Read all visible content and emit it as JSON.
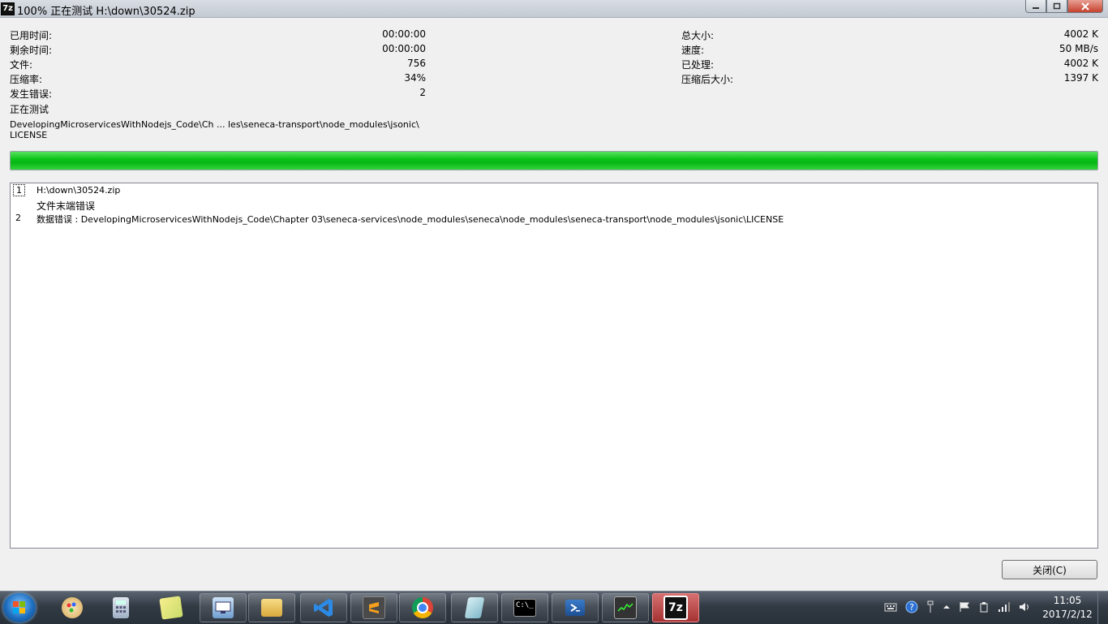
{
  "window": {
    "app_icon": "7z",
    "title": "100% 正在测试 H:\\down\\30524.zip",
    "controls": {
      "minimize": "minimize-icon",
      "maximize": "maximize-icon",
      "close": "close-icon"
    }
  },
  "stats_left": [
    {
      "label": "已用时间:",
      "value": "00:00:00"
    },
    {
      "label": "剩余时间:",
      "value": "00:00:00"
    },
    {
      "label": "文件:",
      "value": "756"
    },
    {
      "label": "压缩率:",
      "value": "34%"
    },
    {
      "label": "发生错误:",
      "value": "2"
    }
  ],
  "stats_right": [
    {
      "label": "总大小:",
      "value": "4002 K"
    },
    {
      "label": "速度:",
      "value": "50 MB/s"
    },
    {
      "label": "已处理:",
      "value": "4002 K"
    },
    {
      "label": "压缩后大小:",
      "value": "1397 K"
    }
  ],
  "operation": "正在测试",
  "current_path_line1": "DevelopingMicroservicesWithNodejs_Code\\Ch ... les\\seneca-transport\\node_modules\\jsonic\\",
  "current_path_line2": "LICENSE",
  "progress": {
    "percent": 100,
    "color": "#06be14"
  },
  "log": [
    {
      "index": "1",
      "text": "H:\\down\\30524.zip"
    },
    {
      "index": "",
      "text": "文件末端错误"
    },
    {
      "index": "2",
      "text": "数据错误 : DevelopingMicroservicesWithNodejs_Code\\Chapter 03\\seneca-services\\node_modules\\seneca\\node_modules\\seneca-transport\\node_modules\\jsonic\\LICENSE"
    }
  ],
  "close_button": "关闭(C)",
  "taskbar": {
    "apps": [
      "paint-icon",
      "calculator-icon",
      "sticky-notes-icon",
      "remote-desktop-icon",
      "file-explorer-icon",
      "visual-studio-code-icon",
      "sublime-text-icon",
      "chrome-icon",
      "notepad-icon",
      "cmd-icon",
      "powershell-icon",
      "task-manager-icon",
      "7zip-icon"
    ],
    "cmd_glyph": "C:\\_",
    "seven_zip_glyph": "7z",
    "clock_time": "11:05",
    "clock_date": "2017/2/12"
  }
}
